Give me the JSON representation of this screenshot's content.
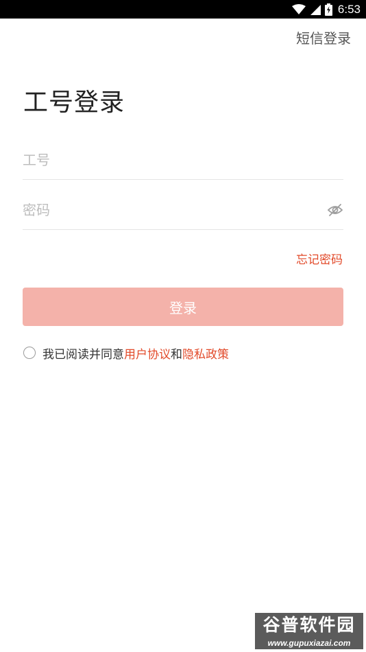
{
  "status_bar": {
    "time": "6:53",
    "icons": [
      "wifi-icon",
      "signal-icon",
      "battery-icon"
    ]
  },
  "header": {
    "sms_login": "短信登录"
  },
  "page": {
    "title": "工号登录"
  },
  "form": {
    "employee_id_placeholder": "工号",
    "employee_id_value": "",
    "password_placeholder": "密码",
    "password_value": "",
    "password_toggle_icon": "eye-off-icon",
    "forgot_password": "忘记密码",
    "login_button": "登录"
  },
  "agreement": {
    "checked": false,
    "prefix": "我已阅读并同意",
    "user_agreement": "用户协议",
    "conjunction": "和",
    "privacy_policy": "隐私政策"
  },
  "watermark": {
    "title": "谷普软件园",
    "url": "www.gupuxiazai.com"
  },
  "colors": {
    "accent": "#e24a2a",
    "button_disabled": "#f4b2aa",
    "placeholder": "#bdbdbd",
    "divider": "#e4e4e4"
  }
}
